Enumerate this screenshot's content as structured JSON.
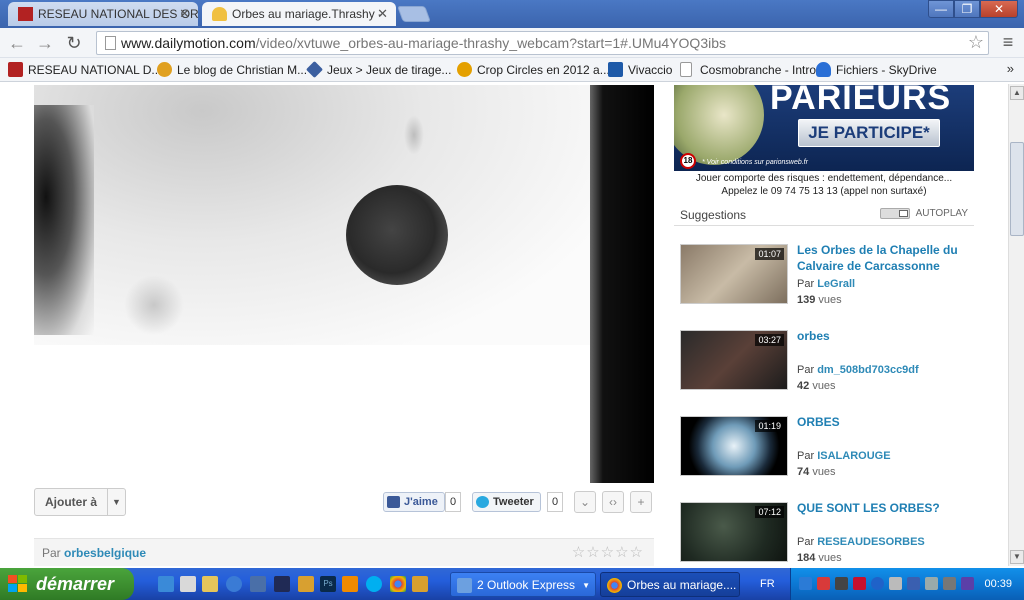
{
  "browser": {
    "tabs": [
      {
        "label": "RESEAU NATIONAL DES ORB"
      },
      {
        "label": "Orbes au mariage.Thrashy -"
      }
    ],
    "url_prefix": "www.dailymotion.com",
    "url_path": "/video/xvtuwe_orbes-au-mariage-thrashy_webcam?start=1#.UMu4YOQ3ibs",
    "window_buttons": {
      "minimize": "—",
      "restore": "❐",
      "close": "✕"
    },
    "bookmarks": [
      {
        "label": "RESEAU NATIONAL D...",
        "color": "#b22222"
      },
      {
        "label": "Le blog de Christian M...",
        "color": "#e0a020"
      },
      {
        "label": "Jeux > Jeux de tirage...",
        "color": "#3b5fa0"
      },
      {
        "label": "Crop Circles en 2012 a...",
        "color": "#e4a000"
      },
      {
        "label": "Vivaccio",
        "color": "#1e5aa8"
      },
      {
        "label": "Cosmobranche - Intro",
        "color": "#ffffff"
      },
      {
        "label": "Fichiers - SkyDrive",
        "color": "#2a6fd6"
      }
    ],
    "bookmarks_more": "»"
  },
  "video_actions": {
    "ajouter": "Ajouter à",
    "like": "J'aime",
    "like_count": "0",
    "tweet": "Tweeter",
    "tweet_count": "0",
    "par_prefix": "Par",
    "author": "orbesbelgique",
    "stars": "☆☆☆☆☆"
  },
  "ad": {
    "headline": "PARIEURS",
    "button": "JE PARTICIPE*",
    "age": "18",
    "conditions": "* Voir conditions sur parionsweb.fr",
    "warning": "Jouer comporte des risques :  endettement, dépendance...",
    "phone": "Appelez le 09 74 75 13 13 (appel non surtaxé)"
  },
  "suggestions": {
    "title": "Suggestions",
    "autoplay": "AUTOPLAY",
    "items": [
      {
        "title": "Les Orbes de la Chapelle du Calvaire de Carcassonne",
        "duration": "01:07",
        "author": "LeGrall",
        "views": "139",
        "views_label": "vues"
      },
      {
        "title": "orbes",
        "duration": "03:27",
        "author": "dm_508bd703cc9df",
        "views": "42",
        "views_label": "vues"
      },
      {
        "title": "ORBES",
        "duration": "01:19",
        "author": "ISALAROUGE",
        "views": "74",
        "views_label": "vues"
      },
      {
        "title": "QUE SONT LES ORBES?",
        "duration": "07:12",
        "author": "RESEAUDESORBES",
        "views": "184",
        "views_label": "vues"
      }
    ],
    "par_prefix": "Par"
  },
  "taskbar": {
    "start": "démarrer",
    "tasks": [
      {
        "label": "2 Outlook Express"
      },
      {
        "label": "Orbes au mariage...."
      }
    ],
    "lang": "FR",
    "clock": "00:39"
  }
}
